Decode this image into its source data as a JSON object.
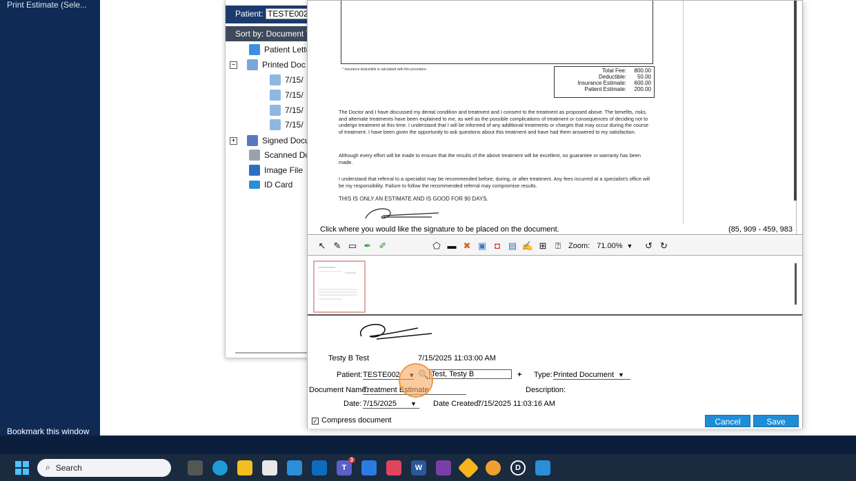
{
  "left_panel": {
    "top_item": "Print Estimate (Sele...",
    "bookmark": "Bookmark this window"
  },
  "doc_window": {
    "patient_label": "Patient:",
    "patient_value": "TESTE002",
    "sort_label": "Sort by: Document T",
    "tree": [
      {
        "label": "Patient Lette",
        "icon": "patient-letter-icon"
      },
      {
        "label": "Printed Doc",
        "icon": "printed-document-icon",
        "expander": "−"
      },
      {
        "label": "7/15/",
        "icon": "printed-doc-item-icon"
      },
      {
        "label": "7/15/",
        "icon": "printed-doc-item-icon"
      },
      {
        "label": "7/15/",
        "icon": "printed-doc-item-icon"
      },
      {
        "label": "7/15/",
        "icon": "printed-doc-item-icon"
      },
      {
        "label": "Signed Docu",
        "icon": "signed-document-icon",
        "expander": "+"
      },
      {
        "label": "Scanned Do",
        "icon": "scanned-document-icon"
      },
      {
        "label": "Image File",
        "icon": "image-file-icon"
      },
      {
        "label": "ID Card",
        "icon": "id-card-icon"
      }
    ]
  },
  "document": {
    "footnote": "* Insurance deductible is calculated with this procedure.",
    "fees": [
      {
        "label": "Total Fee:",
        "value": "800.00"
      },
      {
        "label": "Deductible:",
        "value": "50.00"
      },
      {
        "label": "Insurance Estimate:",
        "value": "600.00"
      },
      {
        "label": "Patient Estimate:",
        "value": "200.00"
      }
    ],
    "para1": "The Doctor and I have discussed my dental condition and treatment and I consent to the treatment as proposed above. The benefits, risks, and alternate treatments have been explained to me, as well as the possible complications of treatment or consequences of deciding not to undergo treatment at this time. I understand that I will be informed of any additional treatments or charges that may occur during the course of treatment. I have been given the opportunity to ask questions about this treatment and have had them answered to my satisfaction.",
    "para2": "Although every effort will be made to ensure that the results of the above treatment will be excellent, no guarantee or warranty has been made.",
    "para3": "I understand that referral to a specialist may be recommended before, during, or after treatment. Any fees incurred at a specialist's office will be my responsibility. Failure to follow the recommended referral may compromise results.",
    "estimate_note": "THIS IS ONLY AN ESTIMATE AND IS GOOD FOR 90 DAYS."
  },
  "preview": {
    "hint": "Click where you would like the signature to be placed on the document.",
    "coords": "(85, 909 - 459, 983"
  },
  "toolbar": {
    "zoom_label": "Zoom:",
    "zoom_value": "71.00%"
  },
  "form": {
    "signer_name": "Testy B Test",
    "signed_datetime": "7/15/2025 11:03:00 AM",
    "patient_label": "Patient:",
    "patient_value": "TESTE002",
    "patient_name": "Test, Testy B",
    "plus": "+",
    "type_label": "Type:",
    "type_value": "Printed Document",
    "doc_name_label": "Document Name:",
    "doc_name_value": "Treatment Estimate",
    "description_label": "Description:",
    "date_label": "Date:",
    "date_value": "7/15/2025",
    "date_created_label": "Date Created:",
    "date_created_value": "7/15/2025 11:03:16 AM",
    "compress_label": "Compress document",
    "cancel_label": "Cancel",
    "save_label": "Save"
  },
  "taskbar": {
    "search_placeholder": "Search",
    "teams_badge": "3"
  }
}
